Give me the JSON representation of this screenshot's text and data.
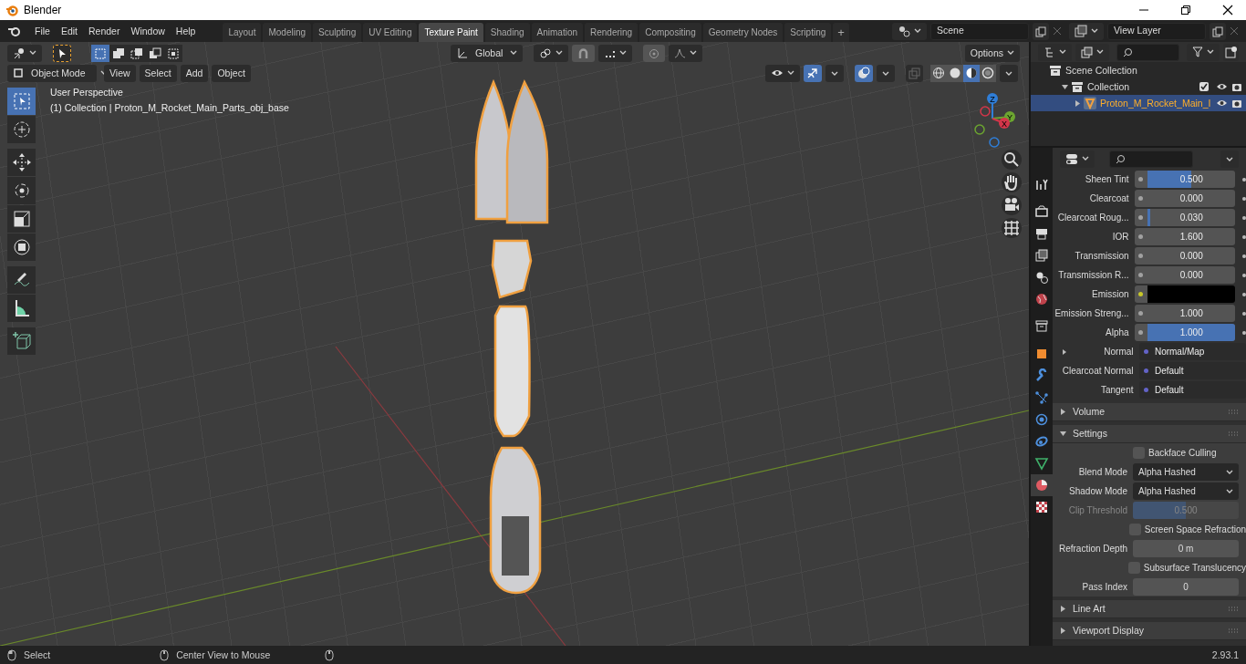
{
  "window": {
    "title": "Blender"
  },
  "menu": [
    "File",
    "Edit",
    "Render",
    "Window",
    "Help"
  ],
  "workspaces": [
    {
      "label": "Layout",
      "selected": false
    },
    {
      "label": "Modeling",
      "selected": false
    },
    {
      "label": "Sculpting",
      "selected": false
    },
    {
      "label": "UV Editing",
      "selected": false
    },
    {
      "label": "Texture Paint",
      "selected": true
    },
    {
      "label": "Shading",
      "selected": false
    },
    {
      "label": "Animation",
      "selected": false
    },
    {
      "label": "Rendering",
      "selected": false
    },
    {
      "label": "Compositing",
      "selected": false
    },
    {
      "label": "Geometry Nodes",
      "selected": false
    },
    {
      "label": "Scripting",
      "selected": false
    }
  ],
  "add_workspace": "+",
  "scene": {
    "value": "Scene"
  },
  "view_layer": {
    "value": "View Layer"
  },
  "tool_header": {
    "select_modes": [
      {
        "kind": "new",
        "selected": true
      },
      {
        "kind": "extend",
        "selected": false
      },
      {
        "kind": "subtract",
        "selected": false
      },
      {
        "kind": "invert",
        "selected": false
      },
      {
        "kind": "intersect",
        "selected": false
      }
    ],
    "orientation": "Global",
    "options": "Options"
  },
  "viewport_header": {
    "mode": "Object Mode",
    "menus": [
      "View",
      "Select",
      "Add",
      "Object"
    ],
    "shading": [
      {
        "kind": "wireframe",
        "selected": false
      },
      {
        "kind": "solid",
        "selected": false
      },
      {
        "kind": "material",
        "selected": true
      },
      {
        "kind": "rendered",
        "selected": false
      }
    ]
  },
  "viewport": {
    "overlay_text": [
      "User Perspective",
      "(1) Collection | Proton_M_Rocket_Main_Parts_obj_base"
    ],
    "gizmo_labels": [
      "Z",
      "Y",
      "X"
    ]
  },
  "toolbar": [
    {
      "kind": "select",
      "selected": true
    },
    {
      "kind": "cursor",
      "selected": false
    },
    {
      "kind": "move",
      "selected": false
    },
    {
      "kind": "rotate",
      "selected": false
    },
    {
      "kind": "scale",
      "selected": false
    },
    {
      "kind": "transform",
      "selected": false
    },
    {
      "kind": "annotate",
      "selected": false
    },
    {
      "kind": "measure",
      "selected": false
    },
    {
      "kind": "add-cube",
      "selected": false
    }
  ],
  "outliner": {
    "items": [
      {
        "label": "Scene Collection",
        "kind": "scene",
        "children": [
          {
            "label": "Collection",
            "kind": "collection",
            "expanded": true,
            "checked": true,
            "children": [
              {
                "label": "Proton_M_Rocket_Main_I",
                "kind": "object",
                "expanded": false,
                "selected": true
              }
            ]
          }
        ]
      }
    ]
  },
  "properties": {
    "tabs": [
      {
        "kind": "tool",
        "selected": false
      },
      {
        "kind": "render",
        "selected": false
      },
      {
        "kind": "output",
        "selected": false
      },
      {
        "kind": "view-layer",
        "selected": false
      },
      {
        "kind": "scene",
        "selected": false
      },
      {
        "kind": "world",
        "selected": false
      },
      {
        "kind": "collection",
        "selected": false
      },
      {
        "kind": "object",
        "selected": false
      },
      {
        "kind": "modifier",
        "selected": false
      },
      {
        "kind": "particles",
        "selected": false
      },
      {
        "kind": "physics",
        "selected": false
      },
      {
        "kind": "constraint",
        "selected": false
      },
      {
        "kind": "data",
        "selected": false
      },
      {
        "kind": "material",
        "selected": true
      },
      {
        "kind": "texture",
        "selected": false
      }
    ],
    "rows": [
      {
        "label": "Sheen Tint",
        "kind": "slider",
        "value": "0.500",
        "level": 0.5
      },
      {
        "label": "Clearcoat",
        "kind": "slider",
        "value": "0.000",
        "level": 0
      },
      {
        "label": "Clearcoat Roug...",
        "kind": "slider",
        "value": "0.030",
        "level": 0.03
      },
      {
        "label": "IOR",
        "kind": "number",
        "value": "1.600"
      },
      {
        "label": "Transmission",
        "kind": "slider",
        "value": "0.000",
        "level": 0
      },
      {
        "label": "Transmission R...",
        "kind": "slider",
        "value": "0.000",
        "level": 0
      },
      {
        "label": "Emission",
        "kind": "color",
        "color": "#000000"
      },
      {
        "label": "Emission Streng...",
        "kind": "number",
        "value": "1.000"
      },
      {
        "label": "Alpha",
        "kind": "slider",
        "value": "1.000",
        "level": 1
      },
      {
        "label": "Normal",
        "kind": "link",
        "value": "Normal/Map",
        "expanded": false
      },
      {
        "label": "Clearcoat Normal",
        "kind": "link",
        "value": "Default"
      },
      {
        "label": "Tangent",
        "kind": "link",
        "value": "Default"
      }
    ],
    "sections": [
      {
        "title": "Volume",
        "expanded": false
      },
      {
        "title": "Settings",
        "expanded": true,
        "rows": [
          {
            "kind": "checkbox",
            "label": "Backface Culling",
            "checked": false
          },
          {
            "kind": "select",
            "label": "Blend Mode",
            "value": "Alpha Hashed"
          },
          {
            "kind": "select",
            "label": "Shadow Mode",
            "value": "Alpha Hashed"
          },
          {
            "kind": "slider",
            "label": "Clip Threshold",
            "value": "0.500",
            "level": 0.5,
            "disabled": true
          },
          {
            "kind": "checkbox",
            "label": "Screen Space Refraction",
            "checked": false
          },
          {
            "kind": "number",
            "label": "Refraction Depth",
            "value": "0 m"
          },
          {
            "kind": "checkbox",
            "label": "Subsurface Translucency",
            "checked": false
          },
          {
            "kind": "number",
            "label": "Pass Index",
            "value": "0"
          }
        ]
      },
      {
        "title": "Line Art",
        "expanded": false
      },
      {
        "title": "Viewport Display",
        "expanded": false
      }
    ]
  },
  "status_bar": {
    "hints": [
      "Select",
      "Center View to Mouse"
    ],
    "version": "2.93.1"
  }
}
